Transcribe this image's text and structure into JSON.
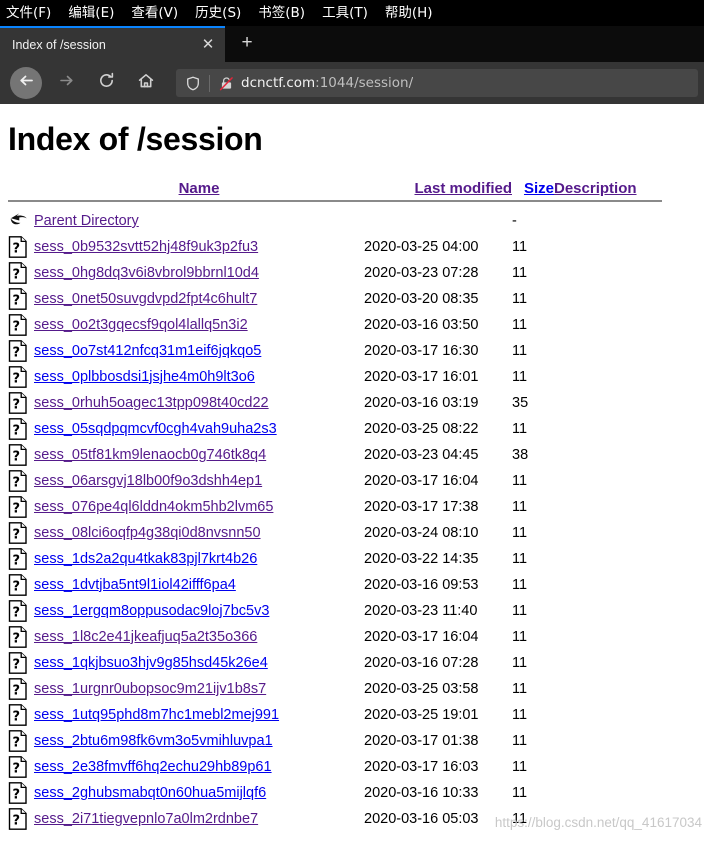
{
  "browser": {
    "menu_items": [
      {
        "label": "文件(F)",
        "accel": "F"
      },
      {
        "label": "编辑(E)",
        "accel": "E"
      },
      {
        "label": "查看(V)",
        "accel": "V"
      },
      {
        "label": "历史(S)",
        "accel": "S"
      },
      {
        "label": "书签(B)",
        "accel": "B"
      },
      {
        "label": "工具(T)",
        "accel": "T"
      },
      {
        "label": "帮助(H)",
        "accel": "H"
      }
    ],
    "tab": {
      "title": "Index of /session",
      "close_label": "✕",
      "new_tab_label": "+"
    },
    "toolbar": {
      "back_icon": "arrow-left-icon",
      "forward_icon": "arrow-right-icon",
      "reload_icon": "reload-icon",
      "home_icon": "home-icon"
    },
    "url_bar": {
      "shield_icon": "shield-icon",
      "lock_icon": "broken-lock-icon",
      "host": "dcnctf.com",
      "rest": ":1044/session/",
      "full_url": "dcnctf.com:1044/session/"
    }
  },
  "page": {
    "title": "Index of /session",
    "columns": {
      "name": "Name",
      "last_modified": "Last modified",
      "size": "Size",
      "description": "Description"
    },
    "column_link_state": {
      "name": "visited",
      "last_modified": "visited",
      "size": "unvisited",
      "description": "visited"
    },
    "parent": {
      "icon": "parent-directory-icon",
      "label": "Parent Directory",
      "last_modified": "",
      "size": "-",
      "description": "",
      "link_state": "visited"
    },
    "entries": [
      {
        "icon": "unknown-file-icon",
        "name": "sess_0b9532svtt52hj48f9uk3p2fu3",
        "last_modified": "2020-03-25 04:00",
        "size": "11",
        "description": "",
        "link_state": "visited"
      },
      {
        "icon": "unknown-file-icon",
        "name": "sess_0hg8dq3v6i8vbrol9bbrnl10d4",
        "last_modified": "2020-03-23 07:28",
        "size": "11",
        "description": "",
        "link_state": "visited"
      },
      {
        "icon": "unknown-file-icon",
        "name": "sess_0net50suvgdvpd2fpt4c6hult7",
        "last_modified": "2020-03-20 08:35",
        "size": "11",
        "description": "",
        "link_state": "visited"
      },
      {
        "icon": "unknown-file-icon",
        "name": "sess_0o2t3gqecsf9qol4lallq5n3i2",
        "last_modified": "2020-03-16 03:50",
        "size": "11",
        "description": "",
        "link_state": "visited"
      },
      {
        "icon": "unknown-file-icon",
        "name": "sess_0o7st412nfcq31m1eif6jqkqo5",
        "last_modified": "2020-03-17 16:30",
        "size": "11",
        "description": "",
        "link_state": "unvisited"
      },
      {
        "icon": "unknown-file-icon",
        "name": "sess_0plbbosdsi1jsjhe4m0h9lt3o6",
        "last_modified": "2020-03-17 16:01",
        "size": "11",
        "description": "",
        "link_state": "unvisited"
      },
      {
        "icon": "unknown-file-icon",
        "name": "sess_0rhuh5oagec13tpp098t40cd22",
        "last_modified": "2020-03-16 03:19",
        "size": "35",
        "description": "",
        "link_state": "visited"
      },
      {
        "icon": "unknown-file-icon",
        "name": "sess_05sqdpqmcvf0cgh4vah9uha2s3",
        "last_modified": "2020-03-25 08:22",
        "size": "11",
        "description": "",
        "link_state": "unvisited"
      },
      {
        "icon": "unknown-file-icon",
        "name": "sess_05tf81km9lenaocb0g746tk8q4",
        "last_modified": "2020-03-23 04:45",
        "size": "38",
        "description": "",
        "link_state": "visited"
      },
      {
        "icon": "unknown-file-icon",
        "name": "sess_06arsgvj18lb00f9o3dshh4ep1",
        "last_modified": "2020-03-17 16:04",
        "size": "11",
        "description": "",
        "link_state": "visited"
      },
      {
        "icon": "unknown-file-icon",
        "name": "sess_076pe4ql6lddn4okm5hb2lvm65",
        "last_modified": "2020-03-17 17:38",
        "size": "11",
        "description": "",
        "link_state": "visited"
      },
      {
        "icon": "unknown-file-icon",
        "name": "sess_08lci6oqfp4g38qi0d8nvsnn50",
        "last_modified": "2020-03-24 08:10",
        "size": "11",
        "description": "",
        "link_state": "visited"
      },
      {
        "icon": "unknown-file-icon",
        "name": "sess_1ds2a2qu4tkak83pjl7krt4b26",
        "last_modified": "2020-03-22 14:35",
        "size": "11",
        "description": "",
        "link_state": "unvisited"
      },
      {
        "icon": "unknown-file-icon",
        "name": "sess_1dvtjba5nt9l1iol42ifff6pa4",
        "last_modified": "2020-03-16 09:53",
        "size": "11",
        "description": "",
        "link_state": "unvisited"
      },
      {
        "icon": "unknown-file-icon",
        "name": "sess_1ergqm8oppusodac9loj7bc5v3",
        "last_modified": "2020-03-23 11:40",
        "size": "11",
        "description": "",
        "link_state": "unvisited"
      },
      {
        "icon": "unknown-file-icon",
        "name": "sess_1l8c2e41jkeafjuq5a2t35o366",
        "last_modified": "2020-03-17 16:04",
        "size": "11",
        "description": "",
        "link_state": "visited"
      },
      {
        "icon": "unknown-file-icon",
        "name": "sess_1qkjbsuo3hjv9g85hsd45k26e4",
        "last_modified": "2020-03-16 07:28",
        "size": "11",
        "description": "",
        "link_state": "unvisited"
      },
      {
        "icon": "unknown-file-icon",
        "name": "sess_1urgnr0ubopsoc9m21ijv1b8s7",
        "last_modified": "2020-03-25 03:58",
        "size": "11",
        "description": "",
        "link_state": "visited"
      },
      {
        "icon": "unknown-file-icon",
        "name": "sess_1utq95phd8m7hc1mebl2mej991",
        "last_modified": "2020-03-25 19:01",
        "size": "11",
        "description": "",
        "link_state": "unvisited"
      },
      {
        "icon": "unknown-file-icon",
        "name": "sess_2btu6m98fk6vm3o5vmihluvpa1",
        "last_modified": "2020-03-17 01:38",
        "size": "11",
        "description": "",
        "link_state": "unvisited"
      },
      {
        "icon": "unknown-file-icon",
        "name": "sess_2e38fmvff6hq2echu29hb89p61",
        "last_modified": "2020-03-17 16:03",
        "size": "11",
        "description": "",
        "link_state": "unvisited"
      },
      {
        "icon": "unknown-file-icon",
        "name": "sess_2ghubsmabqt0n60hua5mijlqf6",
        "last_modified": "2020-03-16 10:33",
        "size": "11",
        "description": "",
        "link_state": "unvisited"
      },
      {
        "icon": "unknown-file-icon",
        "name": "sess_2i71tiegvepnlo7a0lm2rdnbe7",
        "last_modified": "2020-03-16 05:03",
        "size": "11",
        "description": "",
        "link_state": "visited"
      }
    ],
    "watermark": "https://blog.csdn.net/qq_41617034"
  },
  "colors": {
    "link_unvisited": "#0000ee",
    "link_visited": "#551a8b",
    "chrome_dark": "#0c0c0c",
    "chrome_toolbar": "#353535",
    "tab_active_accent": "#0a84ff",
    "urlbar_bg": "#474747"
  }
}
